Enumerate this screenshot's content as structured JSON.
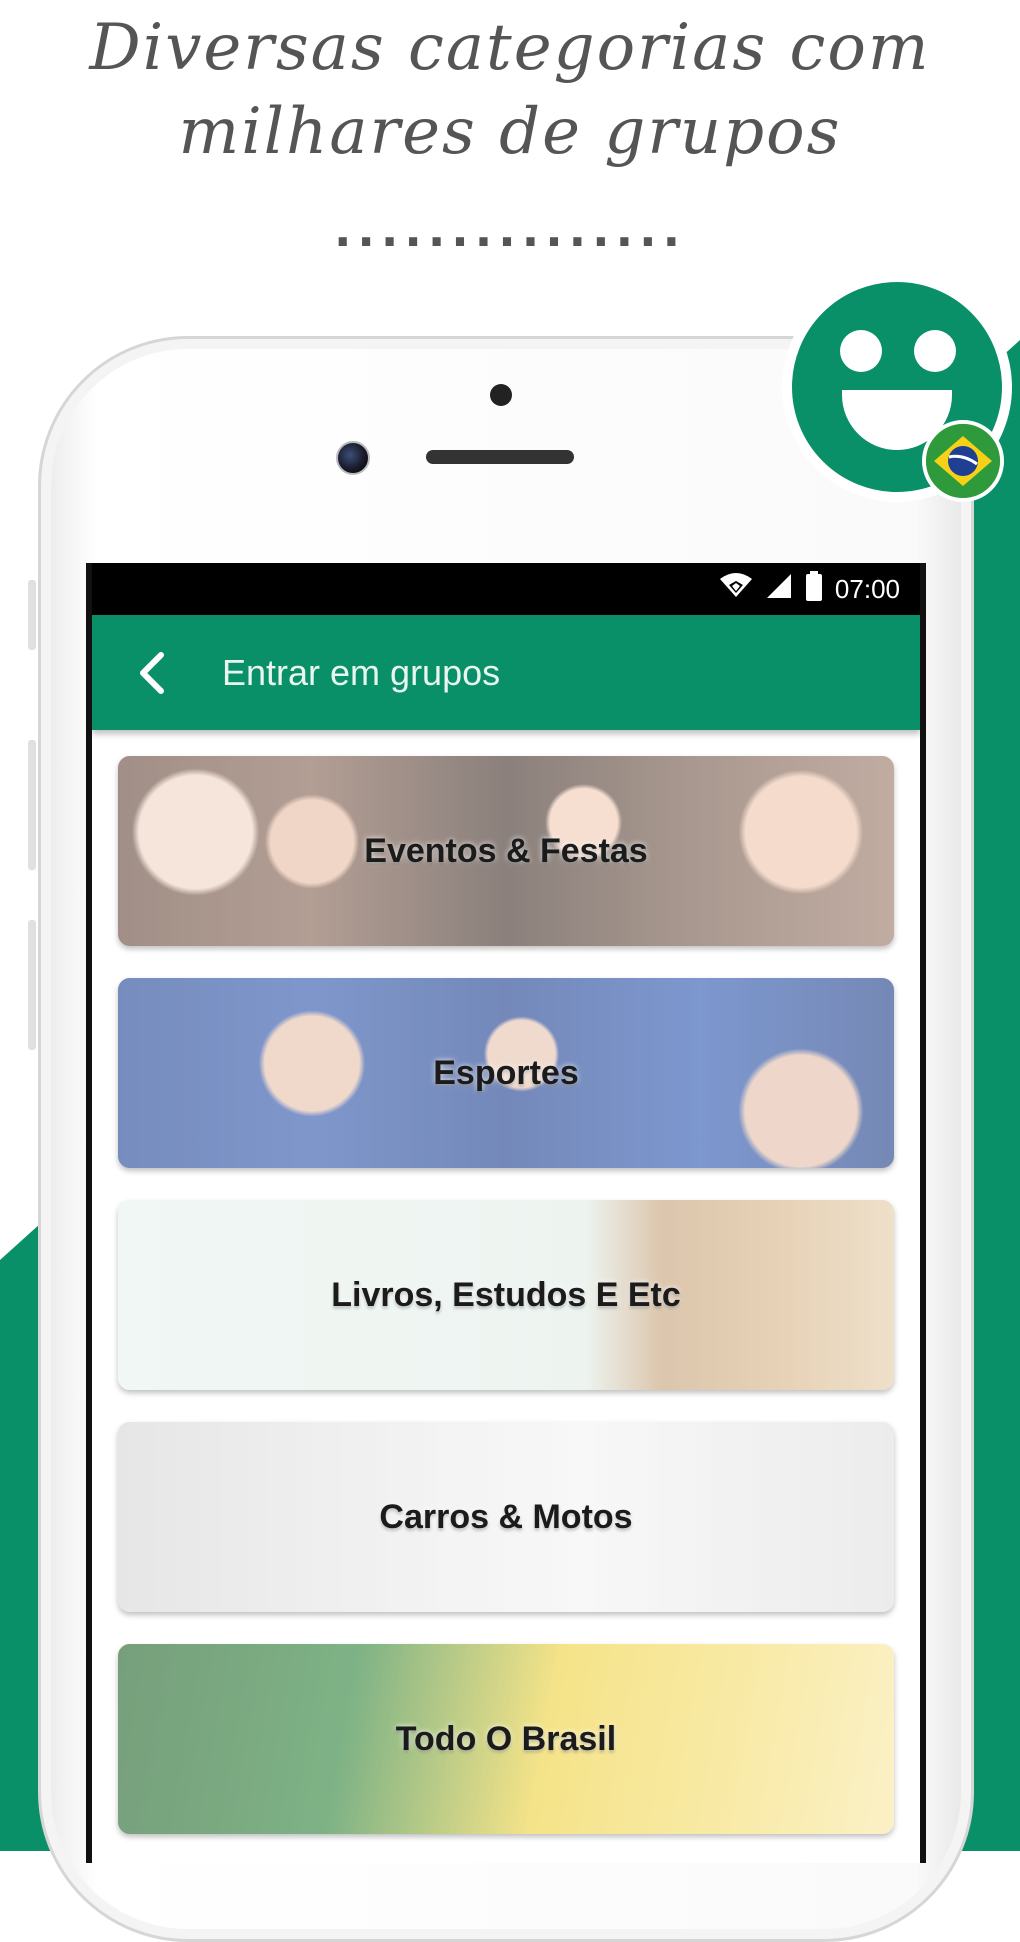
{
  "promo": {
    "headline_line1": "Diversas categorias com",
    "headline_line2": "milhares de grupos",
    "dots": "..............."
  },
  "status_bar": {
    "time": "07:00",
    "icons": [
      "wifi-icon",
      "signal-icon",
      "battery-icon"
    ]
  },
  "app_bar": {
    "back_icon": "chevron-left-icon",
    "title": "Entrar em grupos"
  },
  "categories": [
    {
      "label": "Eventos & Festas"
    },
    {
      "label": "Esportes"
    },
    {
      "label": "Livros, Estudos E Etc"
    },
    {
      "label": "Carros & Motos"
    },
    {
      "label": "Todo O Brasil"
    }
  ],
  "colors": {
    "brand_green": "#0a9068",
    "status_bar": "#000000",
    "headline_text": "#555555"
  },
  "mascot": {
    "icon": "smiley-face-icon",
    "badge_icon": "brazil-flag-icon"
  }
}
